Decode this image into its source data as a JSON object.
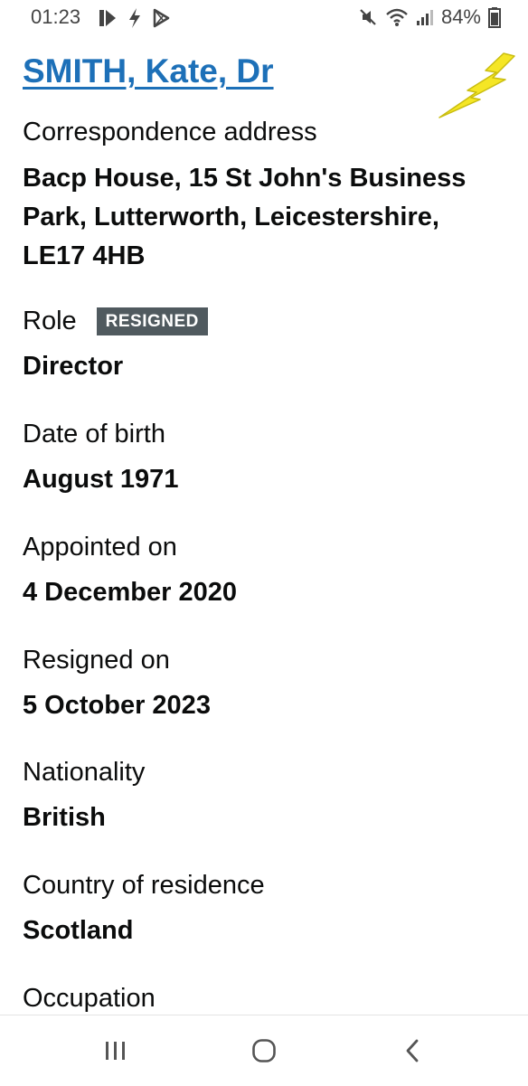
{
  "status_bar": {
    "time": "01:23",
    "battery": "84%",
    "left_icons": [
      "media-play-icon",
      "flash-icon",
      "play-store-icon"
    ],
    "right_icons": [
      "mute-icon",
      "wifi-icon",
      "signal-icon",
      "battery-icon"
    ]
  },
  "officer": {
    "name": "SMITH, Kate, Dr"
  },
  "fields": {
    "address": {
      "label": "Correspondence address",
      "value_lines": [
        "Bacp House, 15 St John's Business",
        "Park, Lutterworth, Leicestershire,",
        "LE17 4HB"
      ]
    },
    "role": {
      "label": "Role",
      "badge": "RESIGNED",
      "value": "Director"
    },
    "dob": {
      "label": "Date of birth",
      "value": "August 1971"
    },
    "appointed": {
      "label": "Appointed on",
      "value": "4 December 2020"
    },
    "resigned": {
      "label": "Resigned on",
      "value": "5 October 2023"
    },
    "nationality": {
      "label": "Nationality",
      "value": "British"
    },
    "residence": {
      "label": "Country of residence",
      "value": "Scotland"
    },
    "occupation": {
      "label": "Occupation"
    }
  },
  "colors": {
    "link": "#1d70b8",
    "badge_bg": "#505a5f",
    "text": "#0b0c0c",
    "bolt": "#f5e625"
  },
  "nav_bar": {
    "buttons": [
      "recent-apps-icon",
      "home-icon",
      "back-icon"
    ]
  }
}
